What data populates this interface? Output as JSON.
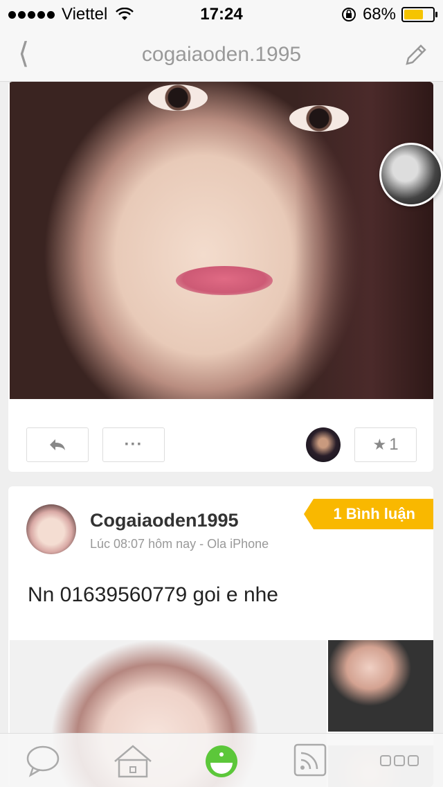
{
  "status_bar": {
    "carrier": "Viettel",
    "time": "17:24",
    "battery": "68%",
    "battery_level": 0.68
  },
  "nav": {
    "title": "cogaiaoden.1995",
    "back_icon": "chevron-left-icon",
    "edit_icon": "pencil-icon"
  },
  "post1": {
    "like_count": "1",
    "more_label": "···",
    "reply_icon": "reply-icon",
    "star_icon": "star-icon"
  },
  "post2": {
    "username": "Cogaiaoden1995",
    "meta": "Lúc 08:07 hôm nay - Ola iPhone",
    "comment_badge": "1 Bình luận",
    "text": "Nn 01639560779 goi e nhe"
  },
  "tabbar": {
    "items": [
      "chat-icon",
      "home-icon",
      "smiley-icon",
      "feed-icon",
      "more-icon"
    ],
    "active_color": "#5cc73a"
  },
  "colors": {
    "badge": "#f9b800",
    "nav_text": "#999999"
  }
}
